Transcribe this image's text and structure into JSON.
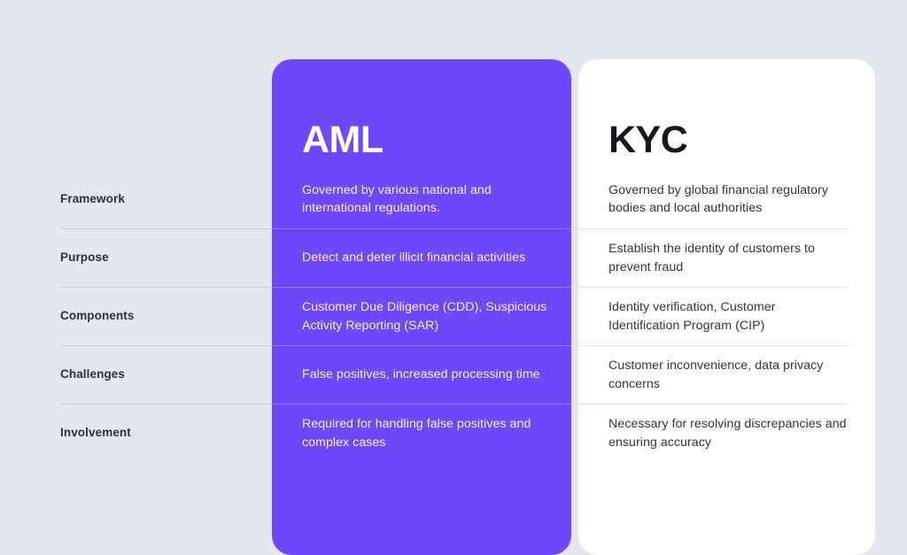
{
  "theme": {
    "background": "#e4e7f0",
    "accent": "#7048fb",
    "card_surface": "#ffffff",
    "label_text": "#2b303c",
    "body_text_light": "#f4f1fe",
    "body_text_dark": "#32363d",
    "divider_left": "#c9cede",
    "divider_accent": "#9577fb",
    "divider_card": "#dfe2e8"
  },
  "comparison": {
    "row_labels": [
      "Framework",
      "Purpose",
      "Components",
      "Challenges",
      "Involvement"
    ],
    "columns": [
      {
        "title": "AML",
        "cells": [
          "Governed by various national and international regulations.",
          "Detect and deter illicit financial activities",
          "Customer Due Diligence (CDD), Suspicious Activity Reporting (SAR)",
          "False positives, increased processing time",
          "Required for handling false positives and complex cases"
        ]
      },
      {
        "title": "KYC",
        "cells": [
          "Governed by global financial regulatory bodies and local authorities",
          "Establish the identity of customers to prevent fraud",
          "Identity verification, Customer Identification Program (CIP)",
          "Customer inconvenience, data privacy concerns",
          "Necessary for resolving discrepancies and ensuring accuracy"
        ]
      }
    ]
  }
}
